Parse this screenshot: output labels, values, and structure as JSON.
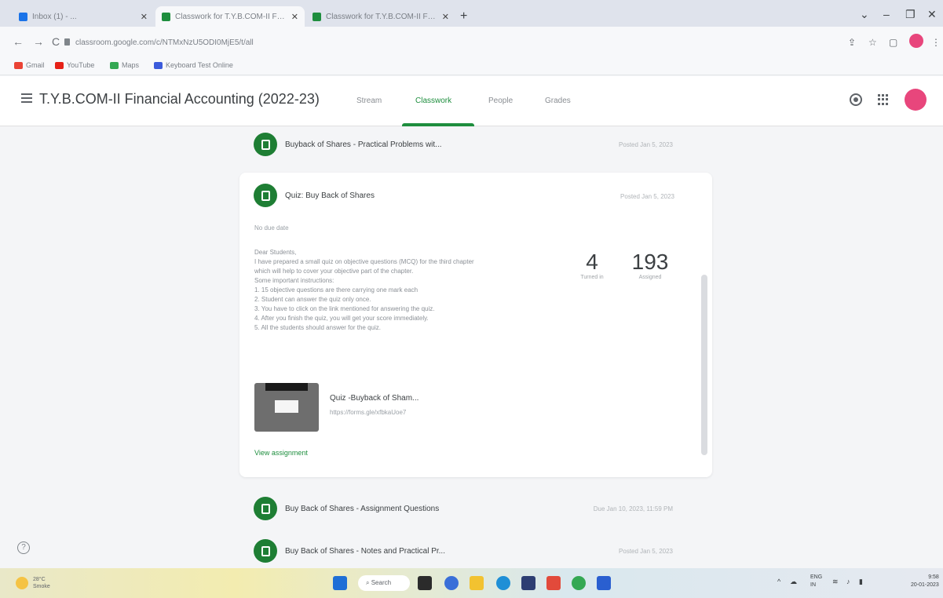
{
  "browser": {
    "tabs": [
      {
        "favicon": "outlook-icon",
        "title": "Inbox (1) - ..."
      },
      {
        "favicon": "classroom-icon",
        "title": "Classwork for T.Y.B.COM-II Fina..."
      },
      {
        "favicon": "classroom-icon",
        "title": "Classwork for T.Y.B.COM-II Finan..."
      }
    ],
    "new_tab": "+",
    "window_controls": {
      "minimize": "–",
      "restore": "❐",
      "close": "✕"
    },
    "nav": {
      "back": "←",
      "forward": "→",
      "reload": "C"
    },
    "url": "classroom.google.com/c/NTMxNzU5ODI0MjE5/t/all",
    "bookmarks": [
      {
        "icon": "gmail-icon",
        "label": "Gmail"
      },
      {
        "icon": "youtube-icon",
        "label": "YouTube"
      },
      {
        "icon": "maps-icon",
        "label": "Maps"
      },
      {
        "icon": "keyboard-icon",
        "label": "Keyboard Test Online"
      }
    ]
  },
  "appbar": {
    "course_title": "T.Y.B.COM-II Financial Accounting (2022-23)",
    "tabs": [
      {
        "label": "Stream",
        "active": false
      },
      {
        "label": "Classwork",
        "active": true
      },
      {
        "label": "People",
        "active": false
      },
      {
        "label": "Grades",
        "active": false
      }
    ]
  },
  "classwork": {
    "items_before": [
      {
        "title": "Buyback of Shares - Practical Problems wit...",
        "date": "Posted Jan 5, 2023"
      }
    ],
    "expanded": {
      "title": "Quiz: Buy Back of Shares",
      "date": "Posted Jan 5, 2023",
      "due": "No due date",
      "description": [
        "Dear Students,",
        "I have prepared a small quiz on objective questions (MCQ) for the third chapter",
        "which will help to cover your objective part of the chapter.",
        "Some important instructions:",
        "1. 15 objective questions are there carrying one mark each",
        "2. Student can answer the quiz only once.",
        "3. You have to click on the link mentioned for answering the quiz.",
        "4. After you finish the quiz, you will get your score immediately.",
        "5. All the students should answer for the quiz."
      ],
      "stats": [
        {
          "value": "4",
          "label": "Turned in"
        },
        {
          "value": "193",
          "label": "Assigned"
        }
      ],
      "attachment": {
        "title": "Quiz -Buyback of Sham...",
        "url": "https://forms.gle/xfbkaUoe7"
      },
      "view_link": "View assignment"
    },
    "items_after": [
      {
        "title": "Buy Back of Shares - Assignment Questions",
        "date": "Due Jan 10, 2023, 11:59 PM"
      },
      {
        "title": "Buy Back of Shares - Notes and Practical Pr...",
        "date": "Posted Jan 5, 2023"
      }
    ]
  },
  "help": "?",
  "taskbar": {
    "weather_temp": "28°C",
    "weather_desc": "Smoke",
    "search_label": "Search",
    "lang": "ENG",
    "lang_sub": "IN",
    "time": "9:58",
    "date": "20-01-2023"
  },
  "colors": {
    "accent_green": "#1e8e3e",
    "item_icon_green": "#1e7e34",
    "avatar_pink": "#e8467c"
  }
}
